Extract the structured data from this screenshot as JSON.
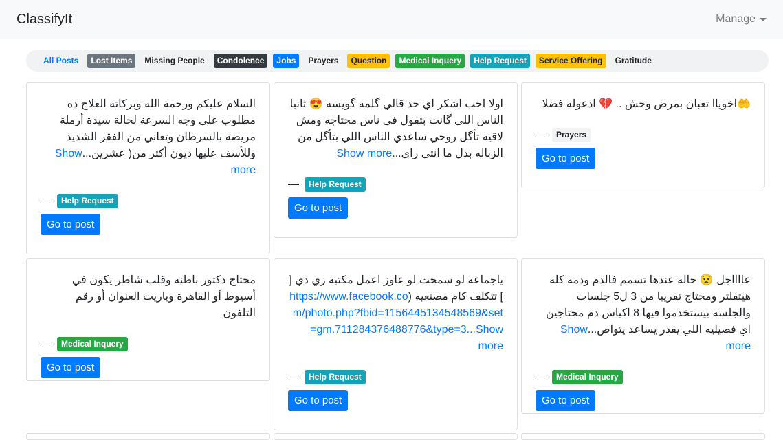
{
  "navbar": {
    "brand": "ClassifyIt",
    "manage": "Manage"
  },
  "tags": [
    {
      "label": "All Posts",
      "bg": "transparent",
      "fg": "#007bff"
    },
    {
      "label": "Lost Items",
      "bg": "#6c757d",
      "fg": "#ffffff"
    },
    {
      "label": "Missing People",
      "bg": "transparent",
      "fg": "#212529"
    },
    {
      "label": "Condolence",
      "bg": "#343a40",
      "fg": "#ffffff"
    },
    {
      "label": "Jobs",
      "bg": "#007bff",
      "fg": "#ffffff"
    },
    {
      "label": "Prayers",
      "bg": "transparent",
      "fg": "#212529"
    },
    {
      "label": "Question",
      "bg": "#ffc107",
      "fg": "#212529"
    },
    {
      "label": "Medical Inquery",
      "bg": "#28a745",
      "fg": "#ffffff"
    },
    {
      "label": "Help Request",
      "bg": "#17a2b8",
      "fg": "#ffffff"
    },
    {
      "label": "Service Offering",
      "bg": "#ffc107",
      "fg": "#212529"
    },
    {
      "label": "Gratitude",
      "bg": "transparent",
      "fg": "#212529"
    }
  ],
  "posts": [
    {
      "text": "السلام عليكم ورحمة الله وبركاته العلاج ده مطلوب على وجه السرعة لحالة سيدة أرملة مريضة بالسرطان وتعاني من الفقر الشديد وللأسف عليها ديون أكثر من( عشرين...",
      "more": "Show more",
      "link": "",
      "category": "Help Request",
      "cat_bg": "#17a2b8",
      "cat_fg": "#ffffff",
      "button": "Go to post"
    },
    {
      "text": "اولا احب اشكر اي حد قالي گلمه گويسه 😍 ثانيا الناس اللي گانت بتقول في ناس محتاجه ومش لاقيه تأگل روحي ساعدي الناس اللي بتأگل من الزباله بدل ما انتي راي...",
      "more": "Show more",
      "link": "",
      "category": "Help Request",
      "cat_bg": "#17a2b8",
      "cat_fg": "#ffffff",
      "button": "Go to post"
    },
    {
      "text": "🤲اخوياا تعبان بمرض وحش .. 💔 ادعوله فضلا",
      "more": "",
      "link": "",
      "category": "Prayers",
      "cat_bg": "#f1f2f4",
      "cat_fg": "#212529",
      "button": "Go to post"
    },
    {
      "text": "محتاج دكتور باطنه وقلب شاطر يكون في أسيوط أو القاهرة وياريت العنوان أو رقم التلفون",
      "more": "",
      "link": "",
      "category": "Medical Inquery",
      "cat_bg": "#28a745",
      "cat_fg": "#ffffff",
      "button": "Go to post"
    },
    {
      "text": "ياجماعه لو سمحت لو عاوز اعمل مكتبه زي دي [ ] تتكلف كام مصنعيه (",
      "more": "Show more",
      "link": "https://www.facebook.com/photo.php?fbid=1156445134548569&set=gm.711284376488776&type=3...",
      "category": "Help Request",
      "cat_bg": "#17a2b8",
      "cat_fg": "#ffffff",
      "button": "Go to post"
    },
    {
      "text": "عااااجل 😟 حاله عندها تسمم فالدم ودمه كله هيتفلتر ومحتاج تقريبا من 3 ل5 جلسات والجلسة بيستخدموا فيها 8 اكياس دم محتاجين اي فصيليه اللي يقدر يساعد يتواص...",
      "more": "Show more",
      "link": "",
      "category": "Medical Inquery",
      "cat_bg": "#28a745",
      "cat_fg": "#ffffff",
      "button": "Go to post"
    }
  ]
}
